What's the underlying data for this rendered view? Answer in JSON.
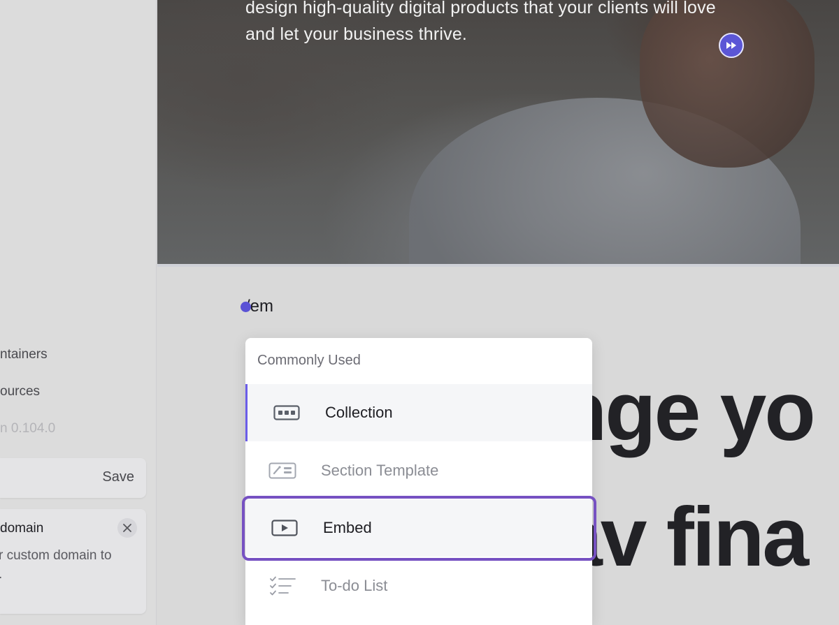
{
  "sidebar": {
    "links": [
      {
        "label": "ntainers"
      },
      {
        "label": "ources"
      }
    ],
    "version": "n 0.104.0",
    "save_label": "Save",
    "domain_card": {
      "title": "domain",
      "desc_line1": "r custom domain to",
      "desc_line2": "."
    }
  },
  "hero": {
    "text": "design high-quality digital products that your clients will love and let your business thrive."
  },
  "editor": {
    "typed_text": "/em",
    "heading_line1": "nge yo",
    "heading_line2": "av fina"
  },
  "menu": {
    "header": "Commonly Used",
    "items": [
      {
        "label": "Collection",
        "icon": "collection-icon",
        "state": "active"
      },
      {
        "label": "Section Template",
        "icon": "section-template-icon",
        "state": "muted"
      },
      {
        "label": "Embed",
        "icon": "embed-icon",
        "state": "highlighted"
      },
      {
        "label": "To-do List",
        "icon": "todo-list-icon",
        "state": "muted"
      }
    ]
  },
  "colors": {
    "accent": "#6b5de8",
    "highlight_border": "#7651c2",
    "cursor": "#5a52d5"
  }
}
